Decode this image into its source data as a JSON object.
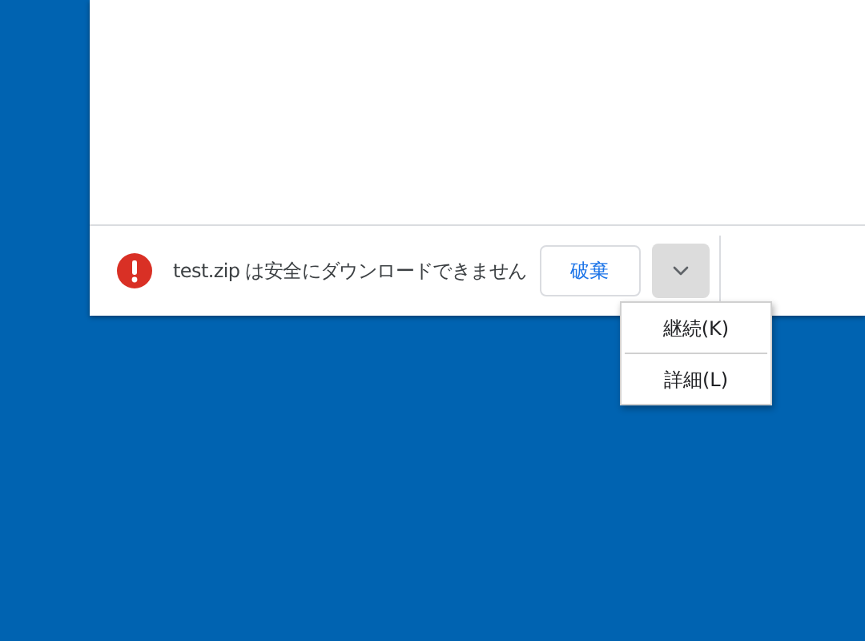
{
  "download_bar": {
    "warning": "test.zip は安全にダウンロードできません",
    "discard_button": "破棄",
    "menu_open": true
  },
  "menu": {
    "items": [
      {
        "label": "継続(K)"
      },
      {
        "label": "詳細(L)"
      }
    ]
  }
}
